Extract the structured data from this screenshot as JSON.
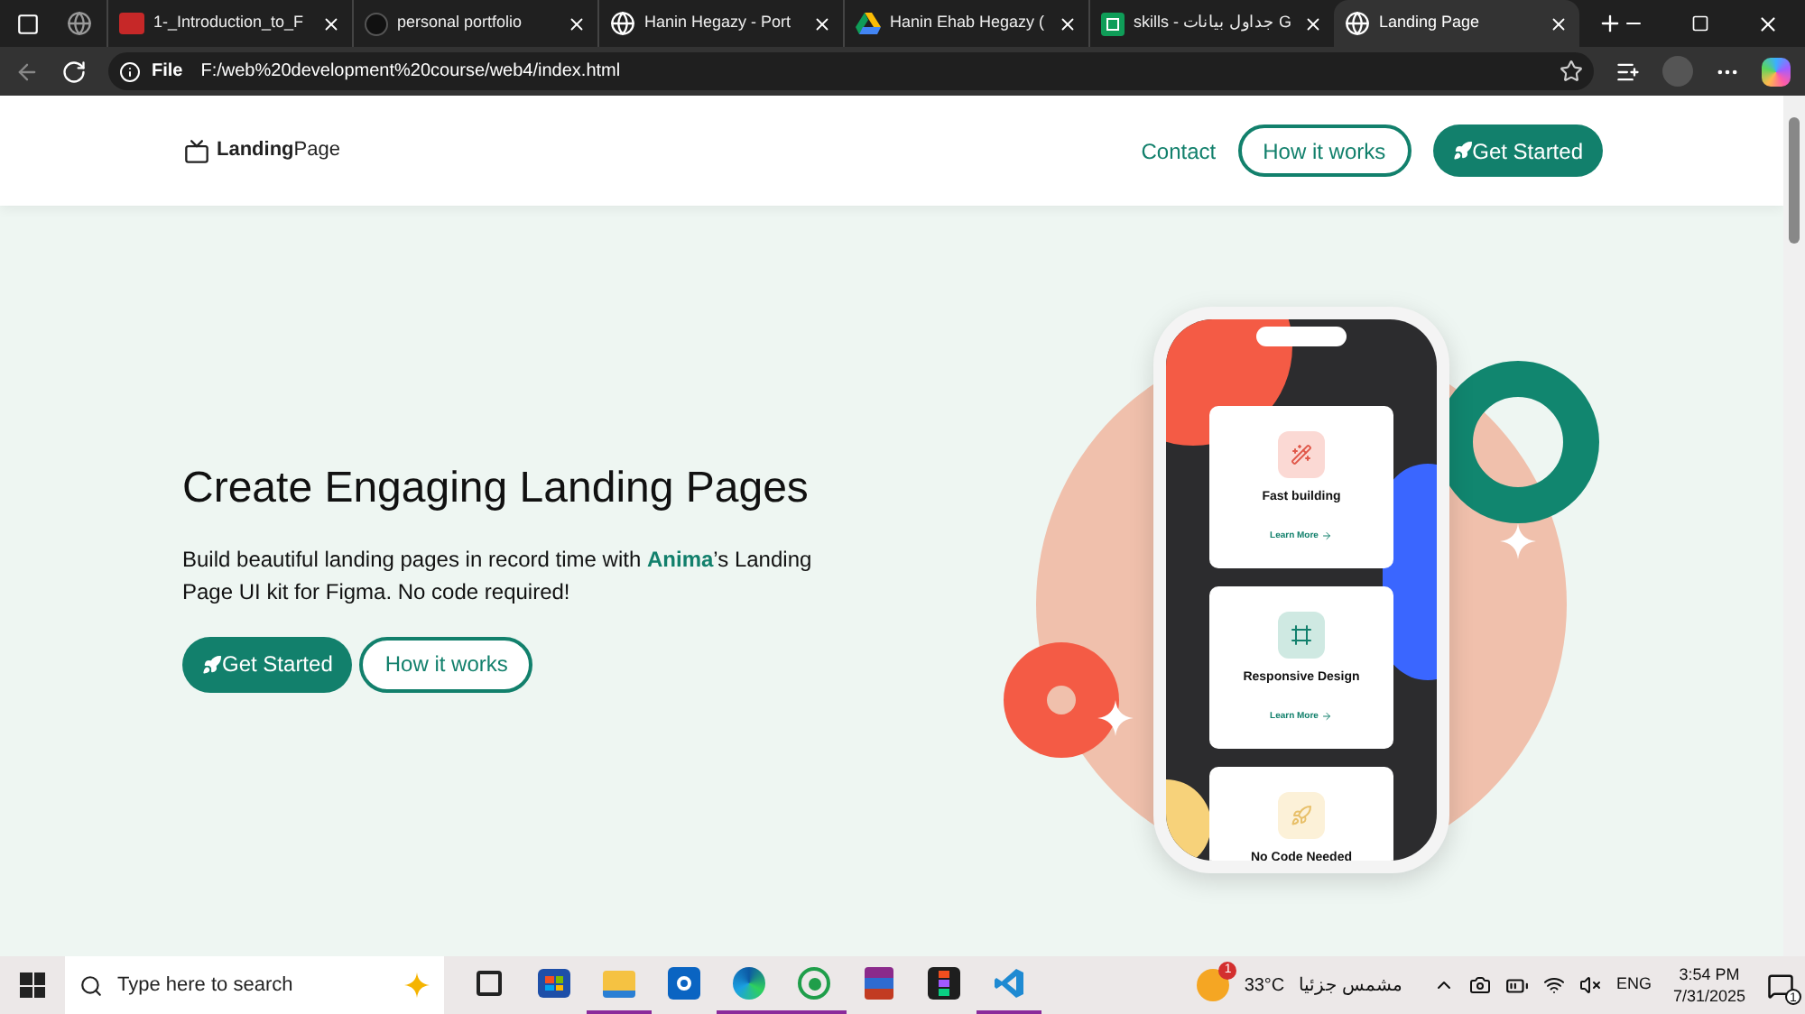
{
  "browser": {
    "tabs": [
      {
        "title": "1-_Introduction_to_F",
        "kind": "pdf",
        "selected": false
      },
      {
        "title": "personal portfolio",
        "kind": "dot",
        "selected": false
      },
      {
        "title": "Hanin Hegazy - Port",
        "kind": "globe",
        "selected": false
      },
      {
        "title": "Hanin Ehab Hegazy (",
        "kind": "drive",
        "selected": false
      },
      {
        "title": "skills - جداول بيانات G",
        "kind": "sheets",
        "selected": false
      },
      {
        "title": "Landing Page",
        "kind": "globe",
        "selected": true
      }
    ],
    "address": {
      "scheme": "File",
      "url": "F:/web%20development%20course/web4/index.html"
    }
  },
  "page": {
    "logo": "**Landing**Page",
    "nav": [
      {
        "label": "Contact",
        "kind": "link"
      },
      {
        "label": "How it works",
        "kind": "outline"
      },
      {
        "label": "Get Started",
        "kind": "filled"
      }
    ],
    "hero": {
      "title": "Create Engaging Landing Pages",
      "text": "Build beautiful landing pages in record time with **Anima**’s Landing Page UI kit for Figma. No code required!",
      "buttons": [
        {
          "label": "Get Started",
          "kind": "filled"
        },
        {
          "label": "How it works",
          "kind": "outline"
        }
      ]
    },
    "phone_cards": [
      {
        "title": "Fast building",
        "link": "Learn More",
        "kind": "magic"
      },
      {
        "title": "Responsive Design",
        "link": "Learn More",
        "kind": "frame"
      },
      {
        "title": "No Code Needed",
        "kind": "rocket"
      }
    ]
  },
  "taskbar": {
    "search_placeholder": "Type here to search",
    "apps": [
      {
        "kind": "taskview",
        "running": false
      },
      {
        "kind": "store",
        "running": false
      },
      {
        "kind": "explorer",
        "running": true
      },
      {
        "kind": "outlook",
        "running": false
      },
      {
        "kind": "edge",
        "running": true
      },
      {
        "kind": "whatsapp",
        "running": true
      },
      {
        "kind": "winrar",
        "running": false
      },
      {
        "kind": "figma",
        "running": false
      },
      {
        "kind": "vscode",
        "running": true
      }
    ],
    "weather": {
      "badge": "1",
      "temp": "33°C",
      "condition": "مشمس جزئيا"
    },
    "language": "ENG",
    "time": "3:54 PM",
    "date": "7/31/2025",
    "notifications": "1"
  }
}
